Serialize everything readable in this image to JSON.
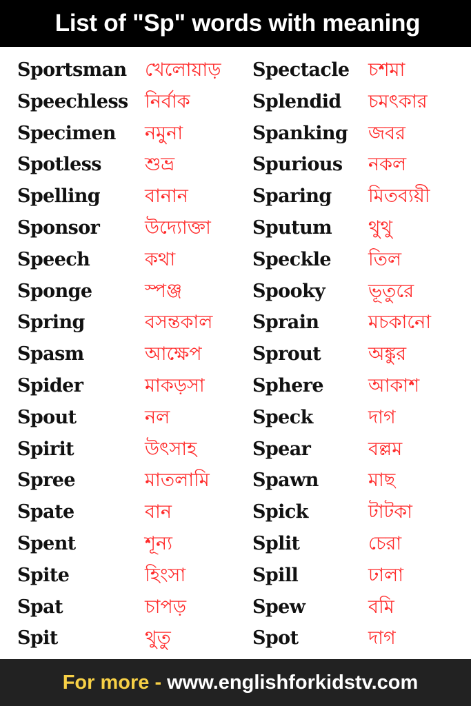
{
  "header": {
    "title": "List of \"Sp\" words with meaning"
  },
  "colors": {
    "header_bg": "#000000",
    "footer_bg": "#222222",
    "english_text": "#111111",
    "bengali_text": "#ff2a2a",
    "footer_prefix": "#f7d046",
    "footer_link": "#ffffff"
  },
  "left_column": [
    {
      "word": "Sportsman",
      "meaning": "খেলোয়াড়"
    },
    {
      "word": "Speechless",
      "meaning": "নির্বাক"
    },
    {
      "word": "Specimen",
      "meaning": "নমুনা"
    },
    {
      "word": "Spotless",
      "meaning": "শুভ্র"
    },
    {
      "word": "Spelling",
      "meaning": "বানান"
    },
    {
      "word": "Sponsor",
      "meaning": "উদ্যোক্তা"
    },
    {
      "word": "Speech",
      "meaning": "কথা"
    },
    {
      "word": "Sponge",
      "meaning": "স্পঞ্জ"
    },
    {
      "word": "Spring",
      "meaning": "বসন্তকাল"
    },
    {
      "word": "Spasm",
      "meaning": "আক্ষেপ"
    },
    {
      "word": "Spider",
      "meaning": "মাকড়সা"
    },
    {
      "word": "Spout",
      "meaning": "নল"
    },
    {
      "word": "Spirit",
      "meaning": "উৎসাহ"
    },
    {
      "word": "Spree",
      "meaning": "মাতলামি"
    },
    {
      "word": "Spate",
      "meaning": "বান"
    },
    {
      "word": "Spent",
      "meaning": "শূন্য"
    },
    {
      "word": "Spite",
      "meaning": "হিংসা"
    },
    {
      "word": "Spat",
      "meaning": "চাপড়"
    },
    {
      "word": "Spit",
      "meaning": "থুতু"
    }
  ],
  "right_column": [
    {
      "word": "Spectacle",
      "meaning": "চশমা"
    },
    {
      "word": "Splendid",
      "meaning": "চমৎকার"
    },
    {
      "word": "Spanking",
      "meaning": "জবর"
    },
    {
      "word": "Spurious",
      "meaning": "নকল"
    },
    {
      "word": "Sparing",
      "meaning": "মিতব্যয়ী"
    },
    {
      "word": "Sputum",
      "meaning": "থুথু"
    },
    {
      "word": "Speckle",
      "meaning": "তিল"
    },
    {
      "word": "Spooky",
      "meaning": "ভূতুরে"
    },
    {
      "word": "Sprain",
      "meaning": "মচকানো"
    },
    {
      "word": "Sprout",
      "meaning": "অঙ্কুর"
    },
    {
      "word": "Sphere",
      "meaning": "আকাশ"
    },
    {
      "word": "Speck",
      "meaning": "দাগ"
    },
    {
      "word": "Spear",
      "meaning": "বল্লম"
    },
    {
      "word": "Spawn",
      "meaning": "মাছ"
    },
    {
      "word": "Spick",
      "meaning": "টাটকা"
    },
    {
      "word": "Split",
      "meaning": "চেরা"
    },
    {
      "word": "Spill",
      "meaning": "ঢালা"
    },
    {
      "word": "Spew",
      "meaning": "বমি"
    },
    {
      "word": "Spot",
      "meaning": "দাগ"
    }
  ],
  "footer": {
    "prefix": "For more -",
    "link_text": "www.englishforkidstv.com"
  }
}
